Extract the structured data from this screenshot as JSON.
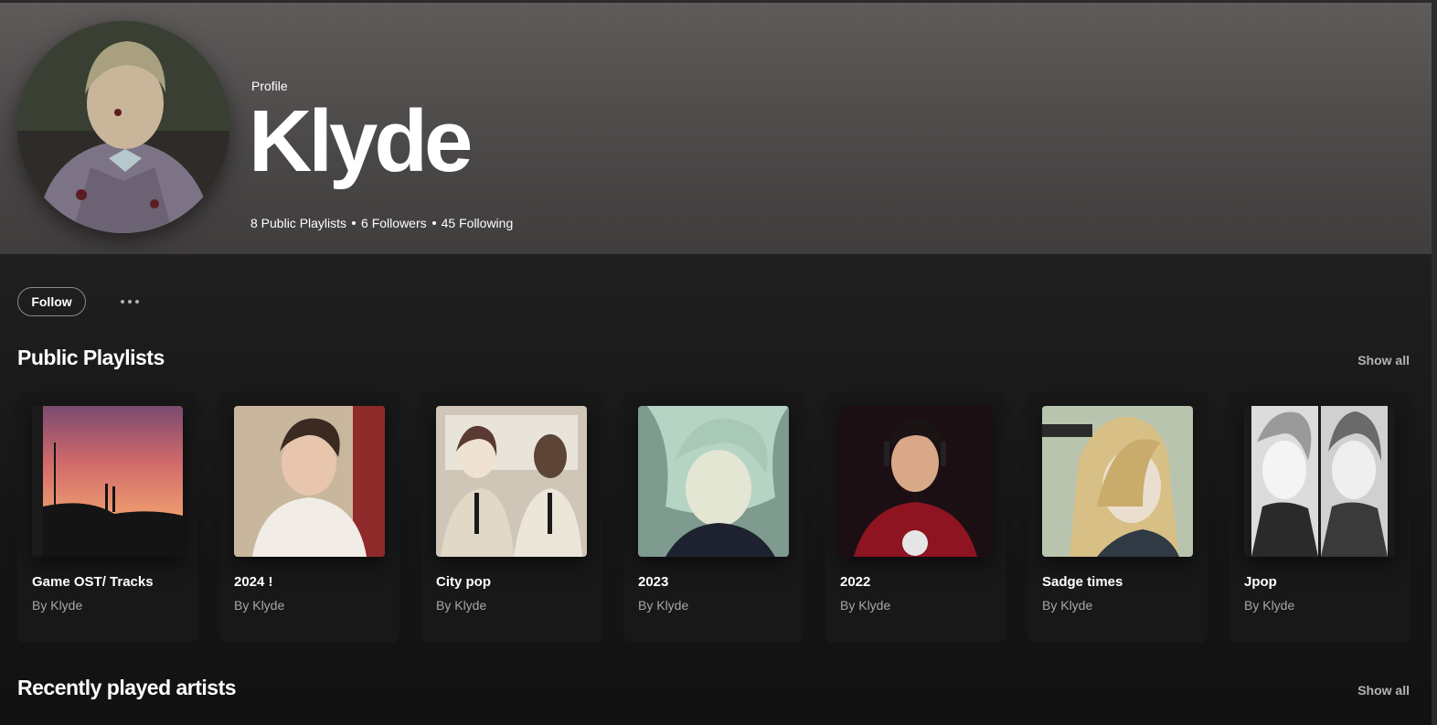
{
  "profile": {
    "label": "Profile",
    "name": "Klyde",
    "stats": {
      "playlists": "8 Public Playlists",
      "followers": "6 Followers",
      "following": "45 Following"
    },
    "avatar_icon": "user-avatar-icon"
  },
  "actions": {
    "follow_label": "Follow",
    "more_icon": "more-options-icon"
  },
  "public_playlists": {
    "title": "Public Playlists",
    "show_all": "Show all",
    "items": [
      {
        "title": "Game OST/ Tracks",
        "subtitle": "By Klyde"
      },
      {
        "title": "2024 !",
        "subtitle": "By Klyde"
      },
      {
        "title": "City pop",
        "subtitle": "By Klyde"
      },
      {
        "title": "2023",
        "subtitle": "By Klyde"
      },
      {
        "title": "2022",
        "subtitle": "By Klyde"
      },
      {
        "title": "Sadge times",
        "subtitle": "By Klyde"
      },
      {
        "title": "Jpop",
        "subtitle": "By Klyde"
      }
    ]
  },
  "recently_played": {
    "title": "Recently played artists",
    "show_all": "Show all"
  },
  "colors": {
    "background": "#121212",
    "header_gradient_top": "#5f5b5b",
    "card": "#181818",
    "muted_text": "#a7a7a7"
  }
}
